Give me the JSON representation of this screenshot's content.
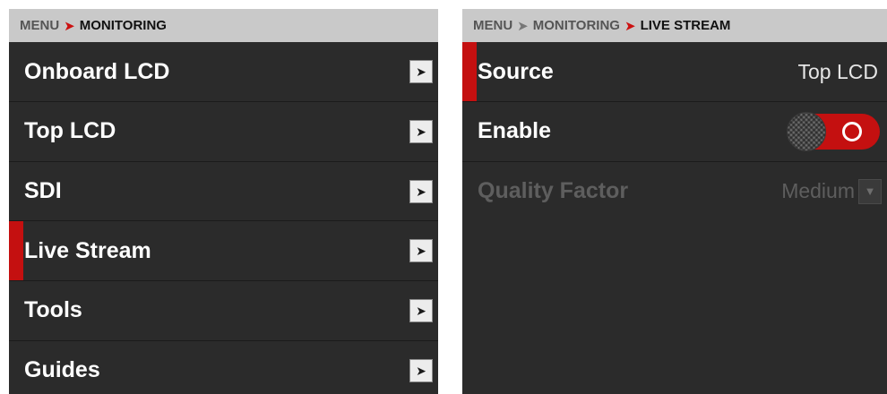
{
  "left_panel": {
    "breadcrumb": {
      "root": "MENU",
      "separator": "➤",
      "current": "MONITORING"
    },
    "items": [
      {
        "label": "Onboard LCD",
        "icon": "chevron-right-icon"
      },
      {
        "label": "Top LCD",
        "icon": "chevron-right-icon"
      },
      {
        "label": "SDI",
        "icon": "chevron-right-icon"
      },
      {
        "label": "Live Stream",
        "icon": "chevron-right-icon",
        "selected": true
      },
      {
        "label": "Tools",
        "icon": "chevron-right-icon"
      },
      {
        "label": "Guides",
        "icon": "chevron-right-icon"
      }
    ],
    "arrow_glyph": "➤"
  },
  "right_panel": {
    "breadcrumb": {
      "root": "MENU",
      "separator": "➤",
      "middle": "MONITORING",
      "current": "LIVE STREAM"
    },
    "rows": {
      "source": {
        "label": "Source",
        "value": "Top LCD",
        "selected": true
      },
      "enable": {
        "label": "Enable",
        "state": "on",
        "icon": "toggle-switch"
      },
      "quality": {
        "label": "Quality Factor",
        "value": "Medium",
        "disabled": true,
        "icon": "dropdown-arrow-icon",
        "glyph": "▼"
      }
    }
  },
  "colors": {
    "accent": "#c41010",
    "panel_bg": "#2b2b2b",
    "header_bg": "#c9c9c9",
    "disabled_text": "#5e5e5e"
  }
}
